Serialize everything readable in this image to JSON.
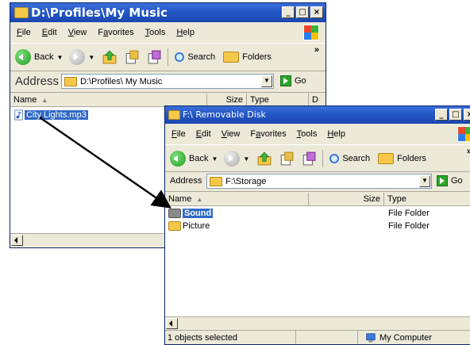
{
  "window1": {
    "title": "D:\\Profiles\\My Music",
    "menu": [
      {
        "label": "File",
        "key": "F",
        "rest": "ile"
      },
      {
        "label": "Edit",
        "key": "E",
        "rest": "dit"
      },
      {
        "label": "View",
        "key": "V",
        "rest": "iew"
      },
      {
        "label": "Favorites",
        "pre": "F",
        "key": "a",
        "rest": "vorites"
      },
      {
        "label": "Tools",
        "key": "T",
        "rest": "ools"
      },
      {
        "label": "Help",
        "key": "H",
        "rest": "elp"
      }
    ],
    "toolbar": {
      "back": "Back",
      "search": "Search",
      "folders": "Folders",
      "more": "»"
    },
    "address": {
      "label": "Address",
      "value": "D:\\Profiles\\ My Music",
      "go": "Go"
    },
    "columns": [
      "Name",
      "Size",
      "Type",
      "D"
    ],
    "files": [
      {
        "name": "City Lights.mp3",
        "selected": true
      }
    ]
  },
  "window2": {
    "title": "F:\\ Removable Disk",
    "menu": [
      {
        "label": "File",
        "key": "F",
        "rest": "ile"
      },
      {
        "label": "Edit",
        "key": "E",
        "rest": "dit"
      },
      {
        "label": "View",
        "key": "V",
        "rest": "iew"
      },
      {
        "label": "Favorites",
        "pre": "F",
        "key": "a",
        "rest": "vorites"
      },
      {
        "label": "Tools",
        "key": "T",
        "rest": "ools"
      },
      {
        "label": "Help",
        "key": "H",
        "rest": "elp"
      }
    ],
    "toolbar": {
      "back": "Back",
      "search": "Search",
      "folders": "Folders",
      "more": "»"
    },
    "address": {
      "label": "Address",
      "value": "F:\\Storage",
      "go": "Go"
    },
    "columns": [
      "Name",
      "Size",
      "Type"
    ],
    "files": [
      {
        "name": "Sound",
        "type": "File Folder",
        "selected": true
      },
      {
        "name": "Picture",
        "type": "File Folder",
        "selected": false
      }
    ],
    "status": {
      "selected": "1 objects selected",
      "location": "My Computer"
    }
  },
  "colors": {
    "title_blue": "#2458c8",
    "selection": "#316ac5",
    "folder": "#f6c84a",
    "chrome": "#ece9d8"
  }
}
